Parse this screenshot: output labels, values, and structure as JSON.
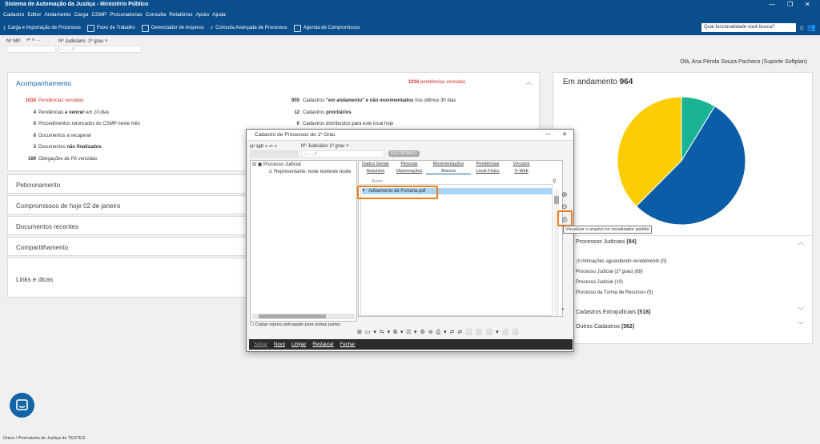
{
  "window": {
    "title": "Sistema de Automação da Justiça - Ministério Público"
  },
  "menu": [
    "Cadastro",
    "Editor",
    "Andamento",
    "Carga",
    "CSMP",
    "Procuradorias",
    "Consulta",
    "Relatórios",
    "Apoio",
    "Ajuda"
  ],
  "toolbar": {
    "items": [
      "Carga e Importação de Processos",
      "Fluxo de Trabalho",
      "Gerenciador de Arquivos",
      "Consulta Avançada de Processos",
      "Agenda de Compromissos"
    ],
    "search_placeholder": "Qual funcionalidade você busca?"
  },
  "filter": {
    "mp_label": "Nº MP",
    "mp_value": "",
    "judicial_label": "Nº Judiciário",
    "judicial_degree": "1º grau",
    "judicial_value": "-  .  .  .  /"
  },
  "greeting": "Olá, Ana Pérola Souza Pacheco (Suporte Softplan)",
  "acompanhamento": {
    "title": "Acompanhamento",
    "header_count": "1016",
    "header_label": "pendências vencidas",
    "left": [
      {
        "n": "1016",
        "t1": "Pendências ",
        "b": "vencidas",
        "t2": ""
      },
      {
        "n": "4",
        "t1": "Pendências ",
        "b": "a vencer",
        "t2": " em 10 dias"
      },
      {
        "n": "0",
        "t1": "Procedimentos retornados do CSMP neste mês",
        "b": "",
        "t2": ""
      },
      {
        "n": "0",
        "t1": "Documentos a recuperar",
        "b": "",
        "t2": ""
      },
      {
        "n": "3",
        "t1": "Documentos ",
        "b": "não finalizados",
        "t2": ""
      },
      {
        "n": "169",
        "t1": "Obrigações de PA vencidas",
        "b": "",
        "t2": ""
      }
    ],
    "right": [
      {
        "n": "955",
        "t1": "Cadastros ",
        "b": "\"em andamento\" e não movimentados",
        "t2": " nos últimos 30 dias"
      },
      {
        "n": "12",
        "t1": "Cadastros ",
        "b": "prioritários",
        "t2": ""
      },
      {
        "n": "0",
        "t1": "Cadastros distribuídos para este local hoje",
        "b": "",
        "t2": ""
      }
    ]
  },
  "sections": [
    "Peticionamento",
    "Compromissos de hoje 02 de janeiro",
    "Documentos recentes",
    "Compartilhamento",
    "Links e dicas"
  ],
  "em_andamento": {
    "title": "Em andamento",
    "count": "964",
    "processos_title": "Processos Judiciais",
    "processos_count": "(84)",
    "processos_items": [
      "Intimações aguardando recebimento (0)",
      "Processo Judicial (2º grau) (69)",
      "Processo Judicial (10)",
      "Processo da Turma de Recursos (5)"
    ],
    "extra_title": "Cadastros Extrajudiciais",
    "extra_count": "(518)",
    "outros_title": "Outros Cadastros",
    "outros_count": "(362)"
  },
  "chart_data": {
    "type": "pie",
    "slices": [
      {
        "label": "Processos Judiciais",
        "value": 84,
        "color": "#1ab394"
      },
      {
        "label": "Cadastros Extrajudiciais",
        "value": 518,
        "color": "#0a5ea8"
      },
      {
        "label": "Outros Cadastros",
        "value": 362,
        "color": "#fccd05"
      }
    ]
  },
  "dialog": {
    "title": "Cadastro de Processos do 1º Grau",
    "mp_label": "Nº MP",
    "judicial_label": "Nº Judiciário",
    "judicial_degree": "1º grau",
    "judicial_value": "-  .  .  .  /",
    "badge": "ELETRÔNICO",
    "tree": {
      "root": "Processo Judicial",
      "child": "Representante: teste testteste testte"
    },
    "tabs_row1": [
      "Dados Gerais",
      "Pessoas",
      "Movimentações",
      "Pendências",
      "Vínculos"
    ],
    "tabs_row2": [
      "Assuntos",
      "Observações",
      "Anexos",
      "Local Físico",
      "Ti-Web"
    ],
    "list_header": "Anexo",
    "file": "Aditamento de Portaria.pdf",
    "tooltip": "Visualizar o arquivo no visualizador padrão",
    "checkbox_label": "Copiar repres./advogado para outras partes",
    "buttons": [
      "Salvar",
      "Novo",
      "Limpar",
      "Restaurar",
      "Fechar"
    ]
  },
  "status": "Único / Promotoria de Justiça de TESTES"
}
